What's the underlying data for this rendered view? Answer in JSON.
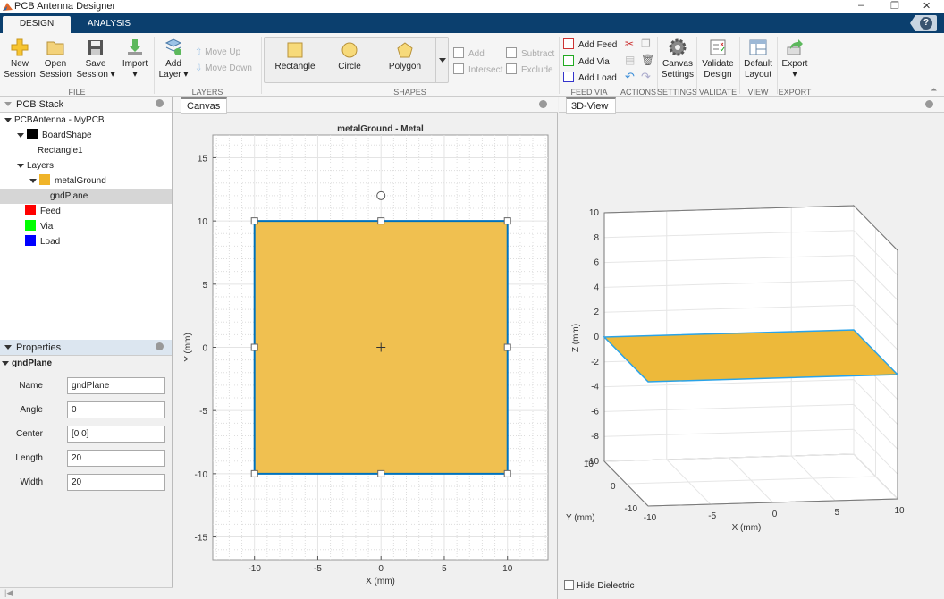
{
  "window": {
    "title": "PCB Antenna Designer",
    "minimize": "–",
    "restore": "❐",
    "close": "✕"
  },
  "tabs": [
    {
      "label": "DESIGN",
      "active": true
    },
    {
      "label": "ANALYSIS",
      "active": false
    }
  ],
  "help": "?",
  "ribbon": {
    "file": {
      "label": "FILE",
      "new": "New\nSession",
      "open": "Open\nSession",
      "save": "Save\nSession ▾",
      "import": "Import\n▾"
    },
    "layers": {
      "label": "LAYERS",
      "add": "Add\nLayer ▾",
      "move_up": "Move Up",
      "move_down": "Move Down"
    },
    "shapes": {
      "label": "SHAPES",
      "rectangle": "Rectangle",
      "circle": "Circle",
      "polygon": "Polygon",
      "add": "Add",
      "subtract": "Subtract",
      "intersect": "Intersect",
      "exclude": "Exclude"
    },
    "feedvia": {
      "label": "FEED VIA",
      "add_feed": "Add Feed",
      "add_via": "Add Via",
      "add_load": "Add Load"
    },
    "actions": {
      "label": "ACTIONS"
    },
    "settings": {
      "label": "SETTINGS",
      "canvas": "Canvas\nSettings"
    },
    "validate": {
      "label": "VALIDATE",
      "validate": "Validate\nDesign"
    },
    "view": {
      "label": "VIEW",
      "default": "Default\nLayout"
    },
    "export": {
      "label": "EXPORT",
      "export": "Export\n▾"
    }
  },
  "pcb_stack": {
    "title": "PCB Stack",
    "root": "PCBAntenna - MyPCB",
    "board": "BoardShape",
    "board_child": "Rectangle1",
    "layers": "Layers",
    "metal": "metalGround",
    "metal_child": "gndPlane",
    "feed": "Feed",
    "via": "Via",
    "load": "Load",
    "colors": {
      "board": "#000000",
      "metal": "#f0b429",
      "feed": "#ff0000",
      "via": "#00ff00",
      "load": "#0000ff"
    }
  },
  "properties": {
    "title": "Properties",
    "object": "gndPlane",
    "fields": [
      {
        "label": "Name",
        "value": "gndPlane"
      },
      {
        "label": "Angle",
        "value": "0"
      },
      {
        "label": "Center",
        "value": "[0 0]"
      },
      {
        "label": "Length",
        "value": "20"
      },
      {
        "label": "Width",
        "value": "20"
      }
    ]
  },
  "canvas": {
    "tab": "Canvas"
  },
  "view3d": {
    "tab": "3D-View",
    "hide_dielectric": "Hide Dielectric",
    "hide_dielectric_checked": false
  },
  "chart_data": [
    {
      "type": "scatter",
      "title": "metalGround - Metal",
      "xlabel": "X (mm)",
      "ylabel": "Y (mm)",
      "xlim": [
        -13.3,
        13.2
      ],
      "ylim": [
        -16.8,
        16.8
      ],
      "xticks": [
        -10,
        -5,
        0,
        5,
        10
      ],
      "yticks": [
        -15,
        -10,
        -5,
        0,
        5,
        10,
        15
      ],
      "grid": true,
      "shapes": [
        {
          "name": "gndPlane",
          "kind": "rectangle",
          "x": [
            -10,
            10
          ],
          "y": [
            -10,
            10
          ],
          "fill": "#f0c050",
          "edge": "#0072bd"
        }
      ]
    },
    {
      "type": "3d",
      "xlabel": "X (mm)",
      "ylabel": "Y (mm)",
      "zlabel": "Z (mm)",
      "xticks": [
        -10,
        -5,
        0,
        5,
        10
      ],
      "yticks": [
        -10,
        0,
        10
      ],
      "zticks": [
        -10,
        -8,
        -6,
        -4,
        -2,
        0,
        2,
        4,
        6,
        8,
        10
      ],
      "zlim": [
        -10,
        10
      ],
      "plate": {
        "x": [
          -10,
          10
        ],
        "y": [
          -10,
          10
        ],
        "z": 0,
        "fill": "#edb93a",
        "edge": "#2aa3e8"
      }
    }
  ]
}
